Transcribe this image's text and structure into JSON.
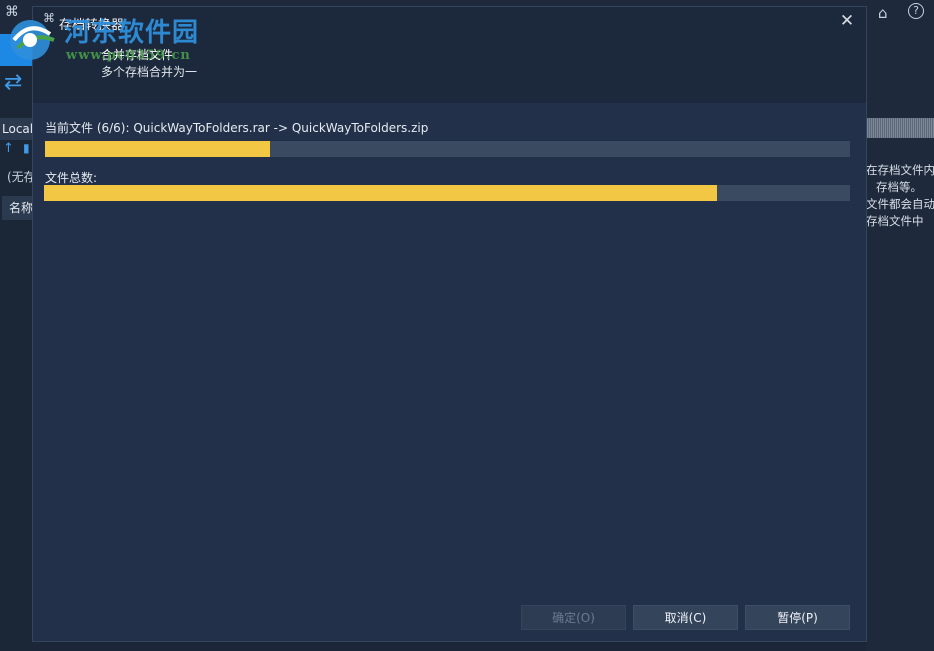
{
  "background": {
    "left_panel": {
      "local_label": "Local",
      "none_label": "(无存",
      "name_header": "名称"
    },
    "right_panel": {
      "lines": [
        "在存档文件内",
        "存档等。",
        "文件都会自动",
        "存档文件中"
      ]
    }
  },
  "watermark": {
    "text": "河东软件园",
    "url": "www.pc0359.cn"
  },
  "dialog": {
    "title": "存档转换器",
    "subtitle": "合并存档文件",
    "description": "多个存档合并为一",
    "current_file": {
      "label": "当前文件 (6/6): QuickWayToFolders.rar -> QuickWayToFolders.zip",
      "progress": 0.28
    },
    "total_files": {
      "label": "文件总数:",
      "progress": 0.835
    },
    "buttons": {
      "ok": "确定(O)",
      "cancel": "取消(C)",
      "pause": "暂停(P)"
    }
  },
  "colors": {
    "progress_fill": "#f2c744",
    "progress_track": "#3a4a61",
    "dialog_bg": "#223149",
    "accent_blue": "#1e88e5"
  },
  "icons": {
    "app": "app-menu-icon",
    "home": "home-icon",
    "help": "help-icon",
    "close": "close-icon",
    "swap": "swap-arrows-icon",
    "up": "arrow-up-icon"
  }
}
